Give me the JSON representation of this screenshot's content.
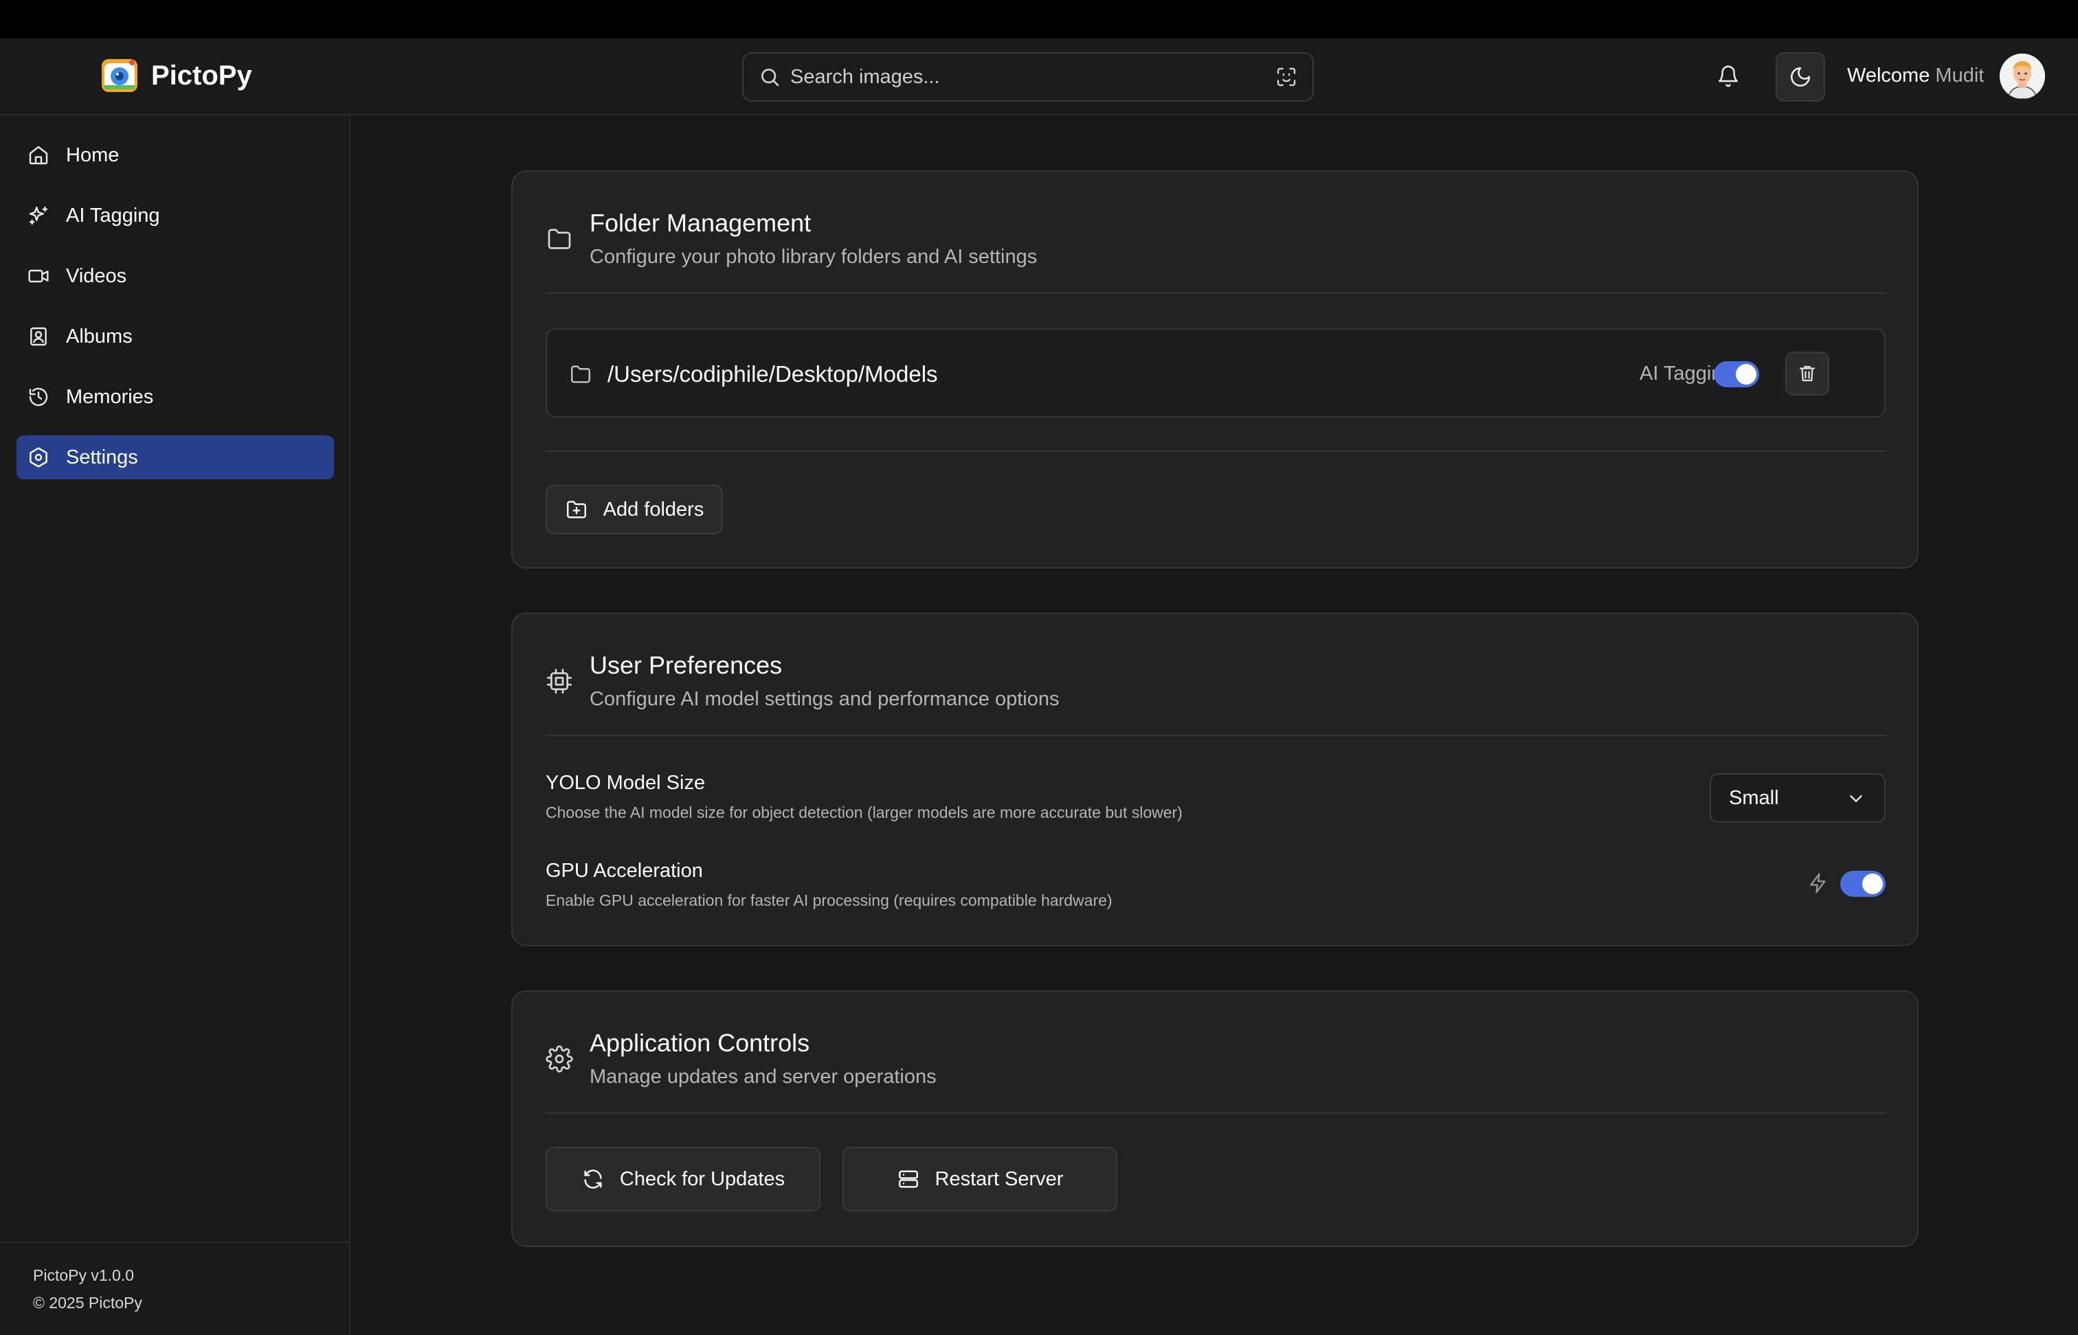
{
  "app": {
    "name": "PictoPy"
  },
  "search": {
    "placeholder": "Search images..."
  },
  "header": {
    "welcome_label": "Welcome",
    "user_name": "Mudit"
  },
  "sidebar": {
    "items": [
      {
        "label": "Home",
        "icon": "home-icon"
      },
      {
        "label": "AI Tagging",
        "icon": "sparkles-icon"
      },
      {
        "label": "Videos",
        "icon": "video-icon"
      },
      {
        "label": "Albums",
        "icon": "album-icon"
      },
      {
        "label": "Memories",
        "icon": "history-icon"
      },
      {
        "label": "Settings",
        "icon": "settings-icon",
        "active": true
      }
    ],
    "version": "PictoPy v1.0.0",
    "copyright": "© 2025 PictoPy"
  },
  "folder_management": {
    "title": "Folder Management",
    "subtitle": "Configure your photo library folders and AI settings",
    "folders": [
      {
        "path": "/Users/codiphile/Desktop/Models",
        "ai_tagging_label": "AI Tagging",
        "ai_tagging": true
      }
    ],
    "add_button": "Add folders"
  },
  "user_preferences": {
    "title": "User Preferences",
    "subtitle": "Configure AI model settings and performance options",
    "yolo": {
      "title": "YOLO Model Size",
      "description": "Choose the AI model size for object detection (larger models are more accurate but slower)",
      "value": "Small"
    },
    "gpu": {
      "title": "GPU Acceleration",
      "description": "Enable GPU acceleration for faster AI processing (requires compatible hardware)",
      "enabled": true
    }
  },
  "application_controls": {
    "title": "Application Controls",
    "subtitle": "Manage updates and server operations",
    "check_updates": "Check for Updates",
    "restart_server": "Restart Server"
  },
  "colors": {
    "accent": "#4a6ee0",
    "active_nav": "#273f8c",
    "background": "#171717",
    "card": "#222222"
  }
}
